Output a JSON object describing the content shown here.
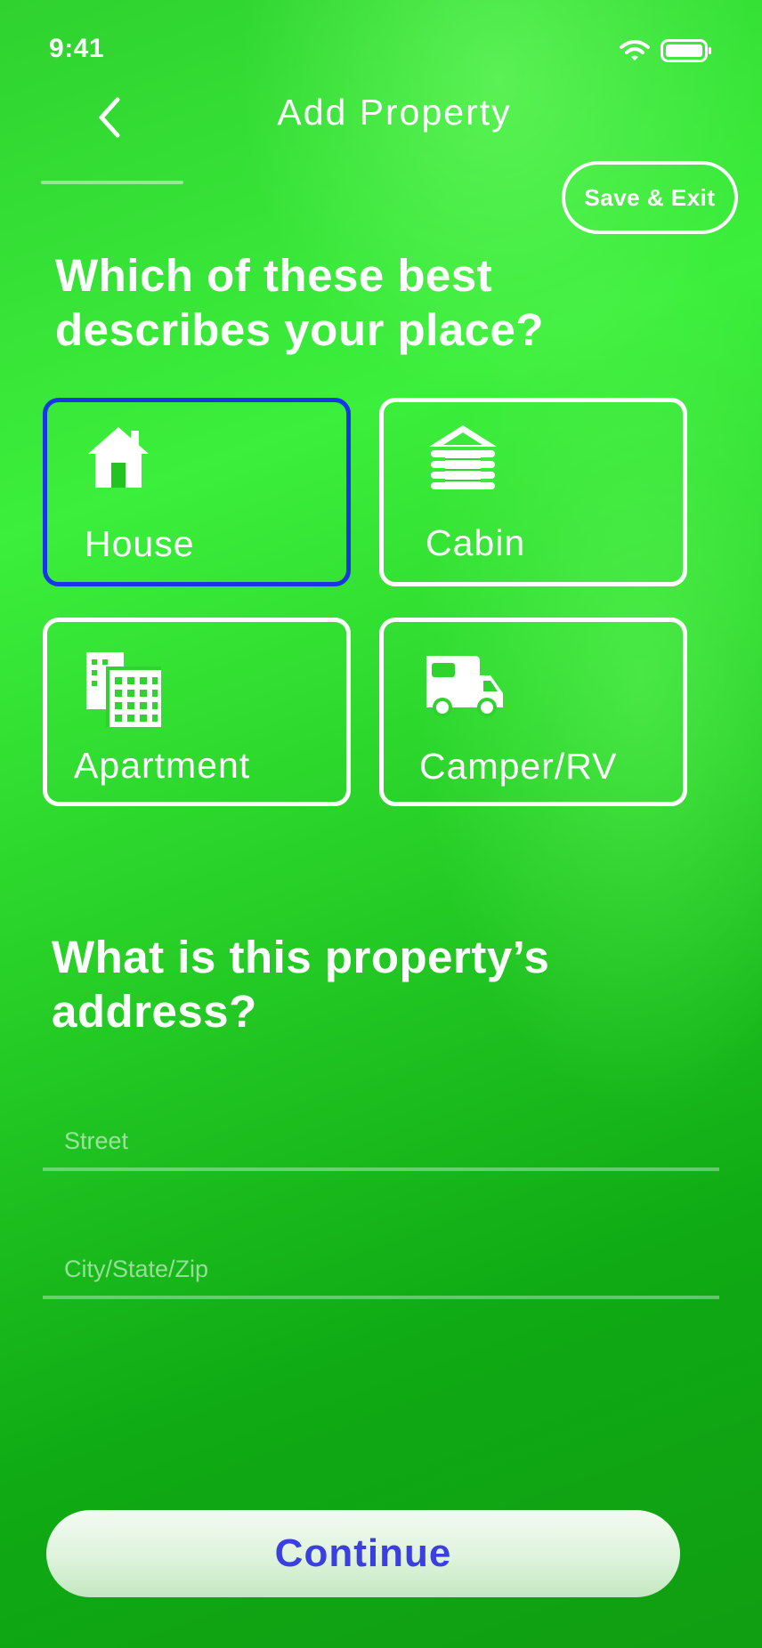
{
  "status_bar": {
    "time": "9:41",
    "icons": [
      "wifi-icon",
      "battery-icon"
    ]
  },
  "header": {
    "title": "Add Property",
    "back_icon": "chevron-left-icon",
    "save_exit_label": "Save & Exit"
  },
  "type_question": {
    "heading": "Which of these best describes your place?",
    "options": [
      {
        "label": "House",
        "icon": "house-icon",
        "selected": true
      },
      {
        "label": "Cabin",
        "icon": "cabin-icon",
        "selected": false
      },
      {
        "label": "Apartment",
        "icon": "apartment-building-icon",
        "selected": false
      },
      {
        "label": "Camper/RV",
        "icon": "camper-rv-icon",
        "selected": false
      }
    ]
  },
  "address_question": {
    "heading": "What is this property’s address?",
    "street": {
      "value": "",
      "placeholder": "Street"
    },
    "city": {
      "value": "",
      "placeholder": "City/State/Zip"
    }
  },
  "continue_label": "Continue",
  "colors": {
    "selected_border": "#1736e6",
    "card_border": "#ffffff",
    "continue_text": "#3b3fe0",
    "background_green": "#2fd22f"
  }
}
